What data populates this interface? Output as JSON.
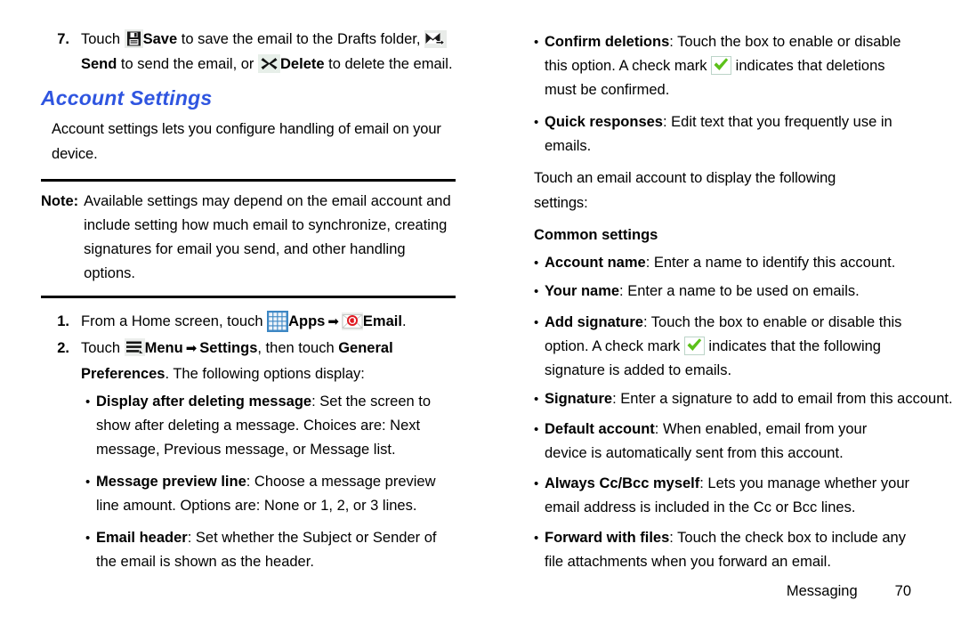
{
  "left_column": {
    "step7": {
      "number": "7.",
      "t1": "Touch ",
      "save_label": "Save",
      "t2": " to save the email to the Drafts folder, ",
      "send_label": "Send",
      "t3": " to send the email, or ",
      "delete_label": "Delete",
      "t4": " to delete the email."
    },
    "heading": "Account Settings",
    "intro": "Account settings lets you configure handling of email on your device.",
    "note": {
      "label": "Note:",
      "text": "Available settings may depend on the email account and include setting how much email to synchronize, creating signatures for email you send, and other handling options."
    },
    "step1": {
      "number": "1.",
      "t1": "From a Home screen, touch ",
      "apps_label": "Apps",
      "arrow": "➡",
      "email_label": "Email",
      "t2": "."
    },
    "step2": {
      "number": "2.",
      "t1": "Touch ",
      "menu_label": "Menu",
      "arrow": "➡",
      "settings_label": "Settings",
      "t2": ", then touch ",
      "general_label": "General Preferences",
      "t3": ". The following options display:"
    },
    "bullets": [
      {
        "term": "Display after deleting message",
        "desc": ": Set the screen to show after deleting a message. Choices are: Next message, Previous message, or Message list."
      },
      {
        "term": "Message preview line",
        "desc": ": Choose a message preview line amount. Options are: None or 1, 2, or 3 lines."
      },
      {
        "term": "Email header",
        "desc": ": Set whether the Subject or Sender of the email is shown as the header."
      }
    ]
  },
  "right_column": {
    "confirm_deletions": {
      "term": "Confirm deletions",
      "d1": ": Touch the box to enable or disable this option. A check mark ",
      "d2": " indicates that deletions must be confirmed."
    },
    "quick_responses": {
      "term": "Quick responses",
      "desc": ": Edit text that you frequently use in emails."
    },
    "touch_account": "Touch an email account to display the following settings:",
    "common_settings_heading": "Common settings",
    "bullets_simple_1": [
      {
        "term": "Account name",
        "desc": ": Enter a name to identify this account."
      },
      {
        "term": "Your name",
        "desc": ": Enter a name to be used on emails."
      }
    ],
    "add_signature": {
      "term": "Add signature",
      "d1": ": Touch the box to enable or disable this option. A check mark ",
      "d2": " indicates that the following signature is added to emails."
    },
    "bullets_simple_2": [
      {
        "term": "Signature",
        "desc": ": Enter a signature to add to email from this account."
      },
      {
        "term": "Default account",
        "desc": ": When enabled, email from your device is automatically sent from this account."
      },
      {
        "term": "Always Cc/Bcc myself",
        "desc": ": Lets you manage whether your email address is included in the Cc or Bcc lines."
      },
      {
        "term": "Forward with files",
        "desc": ": Touch the check box to include any file attachments when you forward an email."
      }
    ]
  },
  "footer": {
    "section": "Messaging",
    "page": "70"
  },
  "bullet_glyph": "•",
  "colors": {
    "heading_blue": "#2f55e0",
    "apps_icon_blue": "#3d87c4",
    "check_green": "#5cc11a",
    "email_badge_red": "#e01a22"
  }
}
